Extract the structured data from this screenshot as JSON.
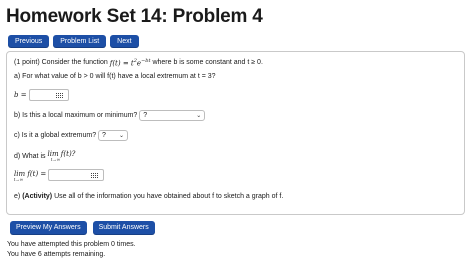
{
  "title": "Homework Set 14: Problem 4",
  "nav": {
    "previous": "Previous",
    "problem_list": "Problem List",
    "next": "Next"
  },
  "problem": {
    "intro_pre": "(1 point) Consider the function",
    "intro_func": "f(t) = t²e^(−bt)",
    "intro_post": "where b is some constant and t ≥ 0.",
    "part_a": "a) For what value of b > 0 will f(t) have a local extremum at t = 3?",
    "b_label": "b =",
    "part_b": "b) Is this a local maximum or minimum?",
    "part_b_select": "?",
    "part_c": "c) Is it a global extremum?",
    "part_c_select": "?",
    "part_d": "d) What is",
    "limit_expr": "lim f(t)?",
    "limit_sub": "t→∞",
    "limit_label": "lim f(t) =",
    "part_e_label": "e)",
    "part_e_bold": "(Activity)",
    "part_e_text": "Use all of the information you have obtained about f to sketch a graph of f."
  },
  "actions": {
    "preview": "Preview My Answers",
    "submit": "Submit Answers"
  },
  "status": {
    "attempted": "You have attempted this problem 0 times.",
    "remaining": "You have 6 attempts remaining."
  }
}
